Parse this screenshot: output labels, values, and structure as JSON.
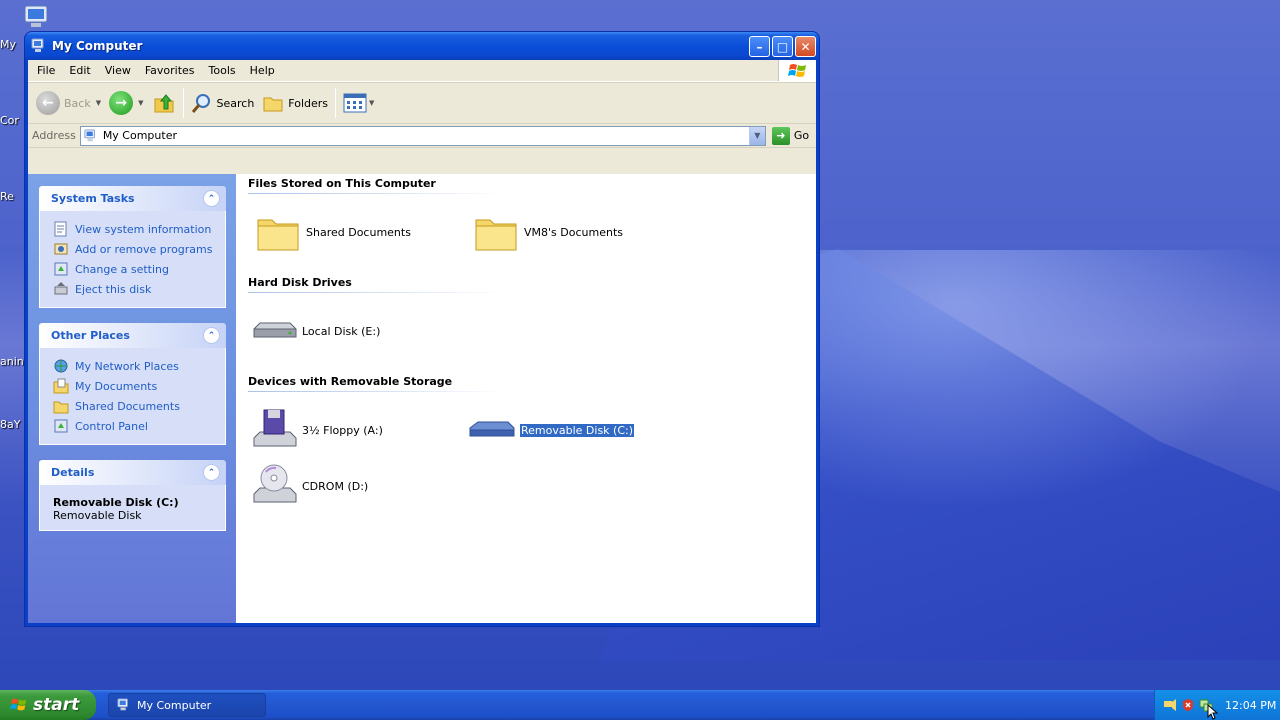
{
  "window": {
    "title": "My Computer",
    "menu": [
      "File",
      "Edit",
      "View",
      "Favorites",
      "Tools",
      "Help"
    ],
    "toolbar": {
      "back_label": "Back",
      "search_label": "Search",
      "folders_label": "Folders"
    },
    "address": {
      "label": "Address",
      "value": "My Computer",
      "go_label": "Go"
    }
  },
  "taskpane": {
    "system_tasks": {
      "title": "System Tasks",
      "links": [
        "View system information",
        "Add or remove programs",
        "Change a setting",
        "Eject this disk"
      ]
    },
    "other_places": {
      "title": "Other Places",
      "links": [
        "My Network Places",
        "My Documents",
        "Shared Documents",
        "Control Panel"
      ]
    },
    "details": {
      "title": "Details",
      "name": "Removable Disk (C:)",
      "type": "Removable Disk"
    }
  },
  "content": {
    "groups": [
      {
        "title": "Files Stored on This Computer",
        "items": [
          "Shared Documents",
          "VM8's Documents"
        ]
      },
      {
        "title": "Hard Disk Drives",
        "items": [
          "Local Disk (E:)"
        ]
      },
      {
        "title": "Devices with Removable Storage",
        "items": [
          "3½ Floppy (A:)",
          "Removable Disk (C:)",
          "CDROM (D:)"
        ]
      }
    ],
    "selected_item": "Removable Disk (C:)"
  },
  "desktop": {
    "icon_labels": [
      "My",
      "Cor",
      "Re",
      "anin",
      "8aY"
    ]
  },
  "taskbar": {
    "start_label": "start",
    "task_button_label": "My Computer",
    "clock": "12:04 PM"
  },
  "colors": {
    "title_blue": "#0a4ed8",
    "link_blue": "#215dc6",
    "selection": "#316ac5",
    "start_green": "#3c9a3c"
  }
}
